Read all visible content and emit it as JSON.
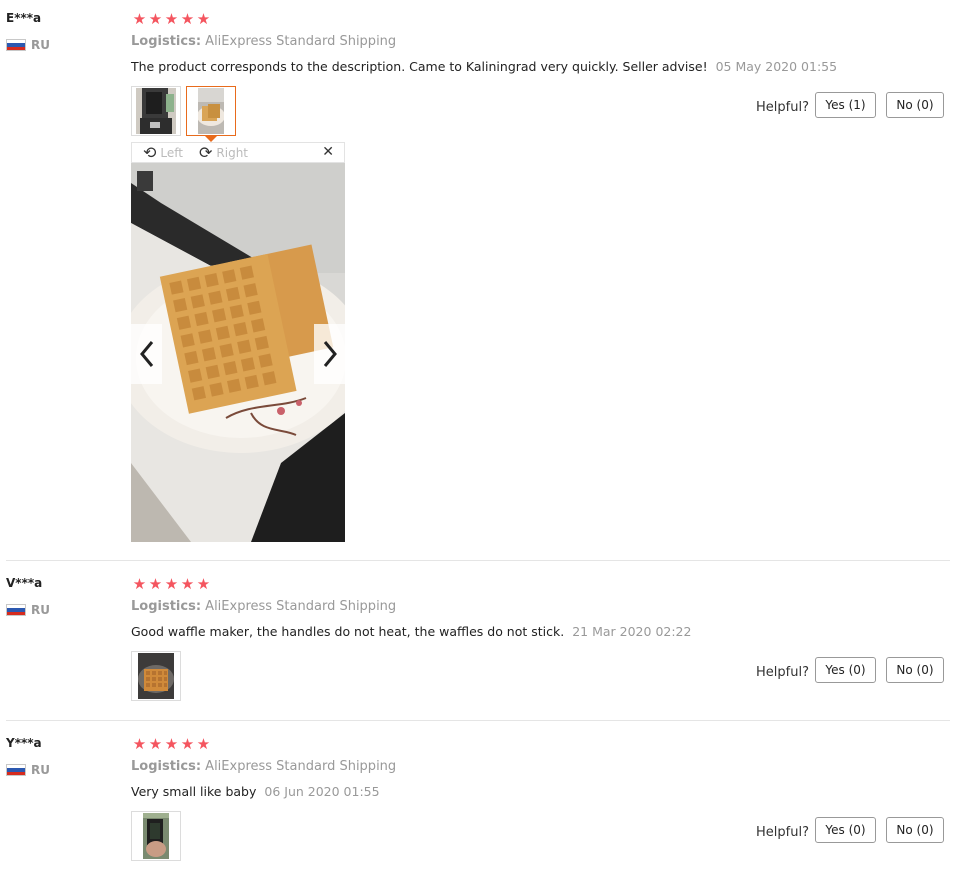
{
  "reviews": [
    {
      "user": "E***a",
      "country": "RU",
      "stars": 5,
      "logistics_label": "Logistics:",
      "logistics_value": "AliExpress Standard Shipping",
      "text": "The product corresponds to the description. Came to Kaliningrad very quickly. Seller advise!",
      "date": "05 May 2020 01:55",
      "helpful_label": "Helpful?",
      "yes_label": "Yes (1)",
      "no_label": "No (0)"
    },
    {
      "user": "V***a",
      "country": "RU",
      "stars": 5,
      "logistics_label": "Logistics:",
      "logistics_value": "AliExpress Standard Shipping",
      "text": "Good waffle maker, the handles do not heat, the waffles do not stick.",
      "date": "21 Mar 2020 02:22",
      "helpful_label": "Helpful?",
      "yes_label": "Yes (0)",
      "no_label": "No (0)"
    },
    {
      "user": "Y***a",
      "country": "RU",
      "stars": 5,
      "logistics_label": "Logistics:",
      "logistics_value": "AliExpress Standard Shipping",
      "text": "Very small like baby",
      "date": "06 Jun 2020 01:55",
      "helpful_label": "Helpful?",
      "yes_label": "Yes (0)",
      "no_label": "No (0)"
    }
  ],
  "viewer": {
    "rotate_left": "Left",
    "rotate_right": "Right",
    "close_symbol": "✕"
  },
  "colors": {
    "star": "#f4555f",
    "active_thumb_border": "#e86b1c",
    "muted_text": "#999999"
  },
  "icons": {
    "star": "★",
    "rotate_left": "⟲",
    "rotate_right": "⟳"
  }
}
